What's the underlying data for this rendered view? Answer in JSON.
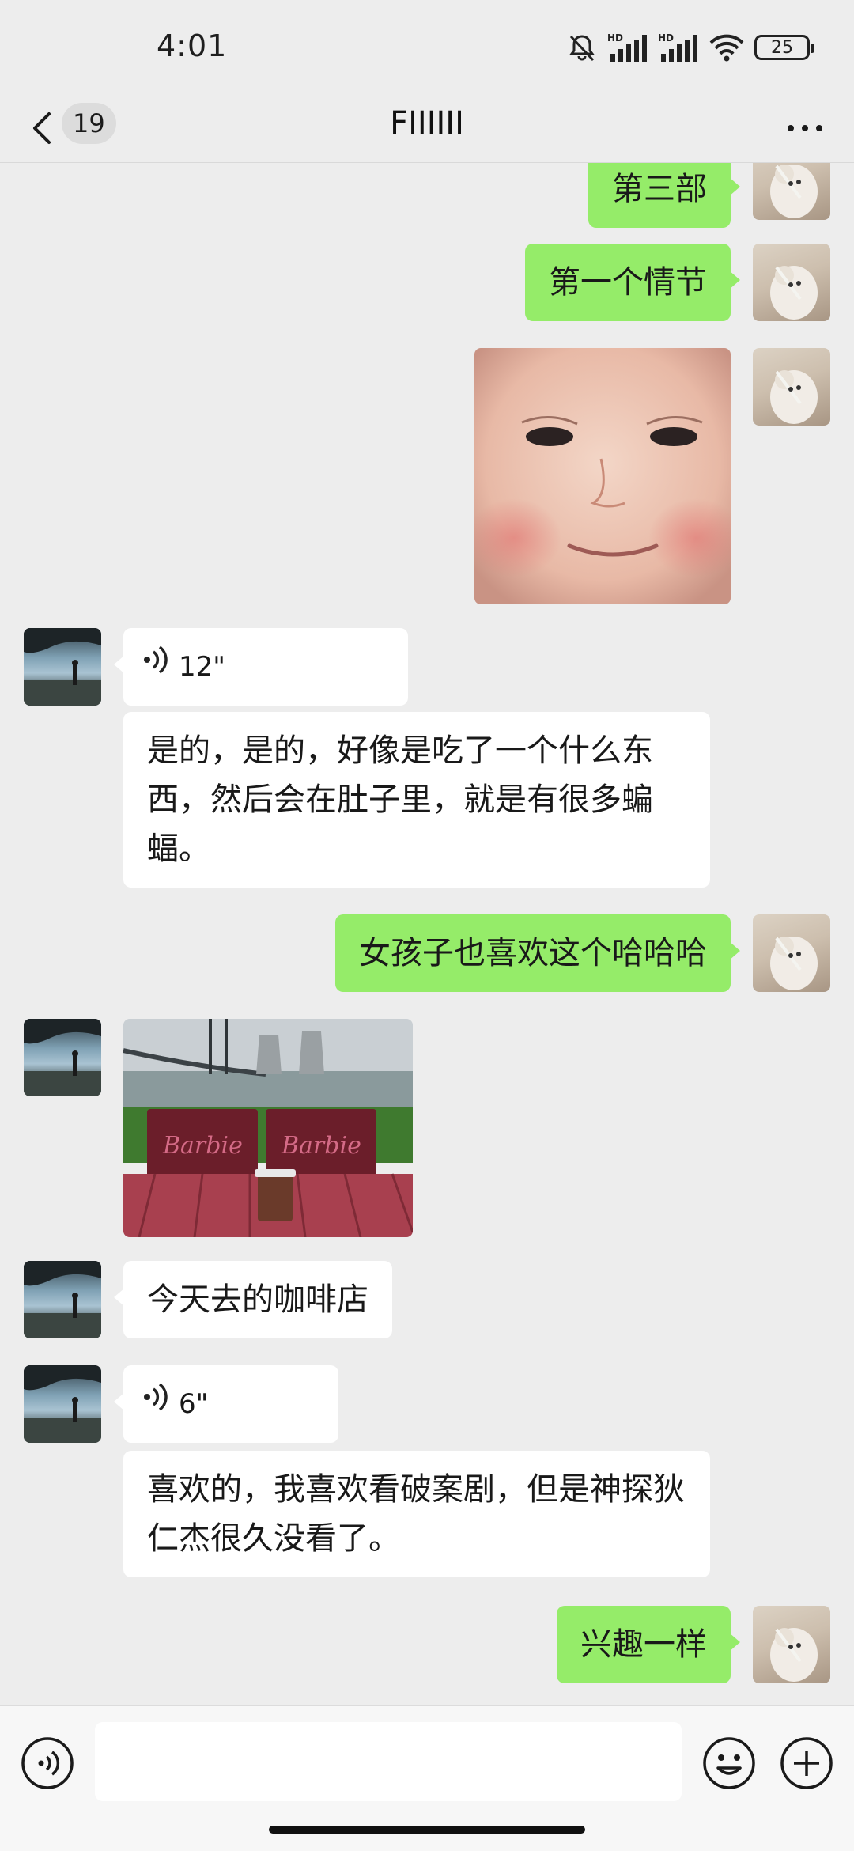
{
  "status_bar": {
    "time": "4:01",
    "battery": "25",
    "icons": [
      "mute-icon",
      "hd-signal-icon",
      "hd-signal-icon",
      "wifi-icon",
      "battery-icon"
    ]
  },
  "nav": {
    "unread_count": "19",
    "title": "FIIIIII",
    "icons": [
      "back-icon",
      "more-icon"
    ]
  },
  "messages": [
    {
      "side": "right",
      "type": "text",
      "text": "第三部"
    },
    {
      "side": "right",
      "type": "text",
      "text": "第一个情节"
    },
    {
      "side": "right",
      "type": "image",
      "description_icon": "baby-face-sticker"
    },
    {
      "side": "left",
      "type": "voice",
      "duration": "12\""
    },
    {
      "side": "left",
      "type": "text",
      "text": "是的，是的，好像是吃了一个什么东西，然后会在肚子里，就是有很多蝙蝠。"
    },
    {
      "side": "right",
      "type": "text",
      "text": "女孩子也喜欢这个哈哈哈"
    },
    {
      "side": "left",
      "type": "image",
      "description_icon": "cafe-photo"
    },
    {
      "side": "left",
      "type": "text",
      "text": "今天去的咖啡店"
    },
    {
      "side": "left",
      "type": "voice",
      "duration": "6\""
    },
    {
      "side": "left",
      "type": "text",
      "text": "喜欢的，我喜欢看破案剧，但是神探狄仁杰很久没看了。"
    },
    {
      "side": "right",
      "type": "text",
      "text": "兴趣一样"
    }
  ],
  "input_bar": {
    "placeholder": "",
    "icons": [
      "voice-input-icon",
      "emoji-icon",
      "plus-icon"
    ]
  },
  "colors": {
    "background": "#ededed",
    "sent_bubble": "#95ec69",
    "received_bubble": "#ffffff"
  }
}
